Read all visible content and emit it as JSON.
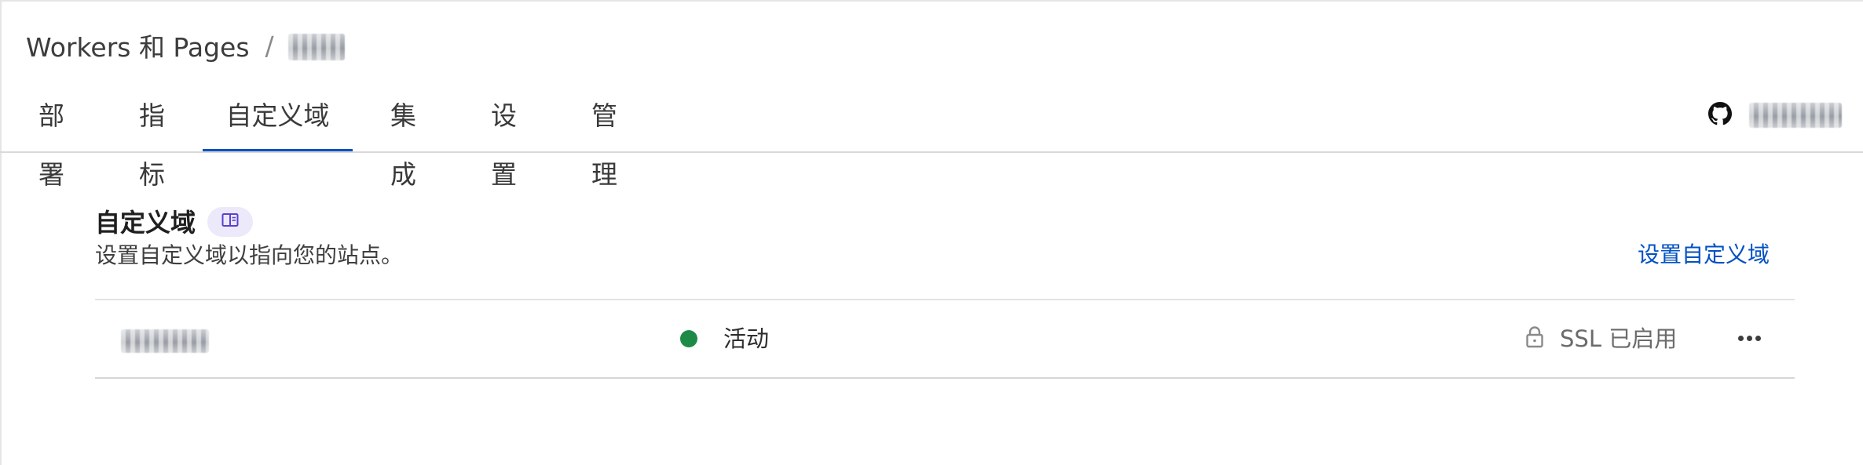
{
  "breadcrumb": {
    "root": "Workers 和 Pages",
    "separator": "/",
    "current_icon": "redacted-project-name"
  },
  "tabs": [
    {
      "label": "部署"
    },
    {
      "label": "指标"
    },
    {
      "label": "自定义域",
      "active": true
    },
    {
      "label": "集成"
    },
    {
      "label": "设置"
    },
    {
      "label": "管理"
    }
  ],
  "repo": {
    "icon": "github-icon",
    "name_icon": "redacted-repo-name"
  },
  "section": {
    "title": "自定义域",
    "doc_icon": "book-icon",
    "description": "设置自定义域以指向您的站点。",
    "setup_link": "设置自定义域"
  },
  "domains": [
    {
      "name_icon": "redacted-domain-name",
      "status": "活动",
      "status_color": "#1e8a48",
      "ssl": "SSL 已启用",
      "ssl_icon": "lock-icon",
      "actions_icon": "more-icon"
    }
  ],
  "colors": {
    "accent": "#0051c3",
    "active_tab_underline": "#0051c3",
    "status_active": "#1e8a48",
    "doc_badge_bg": "#ece9fb"
  }
}
